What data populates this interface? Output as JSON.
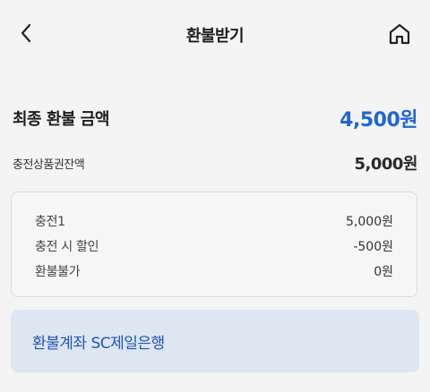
{
  "header": {
    "title": "환불받기",
    "back_icon": "chevron-left-icon",
    "home_icon": "home-icon"
  },
  "summary": {
    "total_label": "최종 환불 금액",
    "total_value": "4,500원",
    "balance_label": "충전상품권잔액",
    "balance_value": "5,000원"
  },
  "breakdown": {
    "rows": [
      {
        "label": "충전1",
        "value": "5,000원"
      },
      {
        "label": "충전 시 할인",
        "value": "-500원"
      },
      {
        "label": "환불불가",
        "value": "0원"
      }
    ]
  },
  "account": {
    "text": "환불계좌 SC제일은행"
  },
  "colors": {
    "accent_blue": "#1f66d1",
    "account_bg": "#dde6f1",
    "account_text": "#2055b8"
  }
}
